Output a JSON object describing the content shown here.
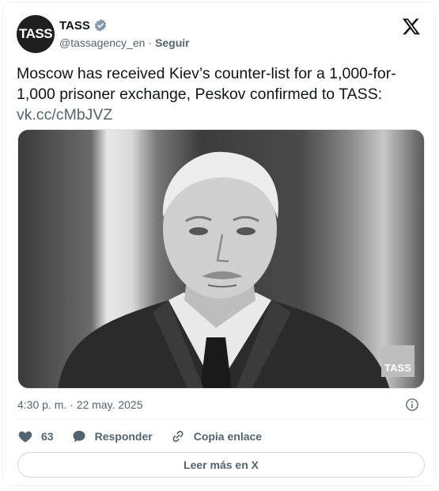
{
  "account": {
    "avatar_text": "TASS",
    "name": "TASS",
    "handle": "@tassagency_en",
    "separator": "·",
    "follow_label": "Seguir"
  },
  "tweet": {
    "text": "Moscow has received Kiev’s counter-list for a 1,000-for-1,000 prisoner exchange, Peskov confirmed to TASS:",
    "link": "vk.cc/cMbJVZ"
  },
  "media": {
    "watermark_text": "TASS"
  },
  "meta": {
    "timestamp": "4:30 p. m. · 22 may. 2025"
  },
  "actions": {
    "like_count": "63",
    "reply_label": "Responder",
    "copy_label": "Copia enlace"
  },
  "read_more_label": "Leer más en X",
  "icons": {
    "verified": "verified-badge-icon",
    "x_logo": "x-logo-icon",
    "info": "info-icon",
    "like": "heart-icon",
    "reply": "speech-bubble-icon",
    "copy": "link-icon"
  },
  "colors": {
    "text": "#0f1419",
    "secondary": "#536471",
    "border": "#eff3f4",
    "verified": "#829aab"
  }
}
